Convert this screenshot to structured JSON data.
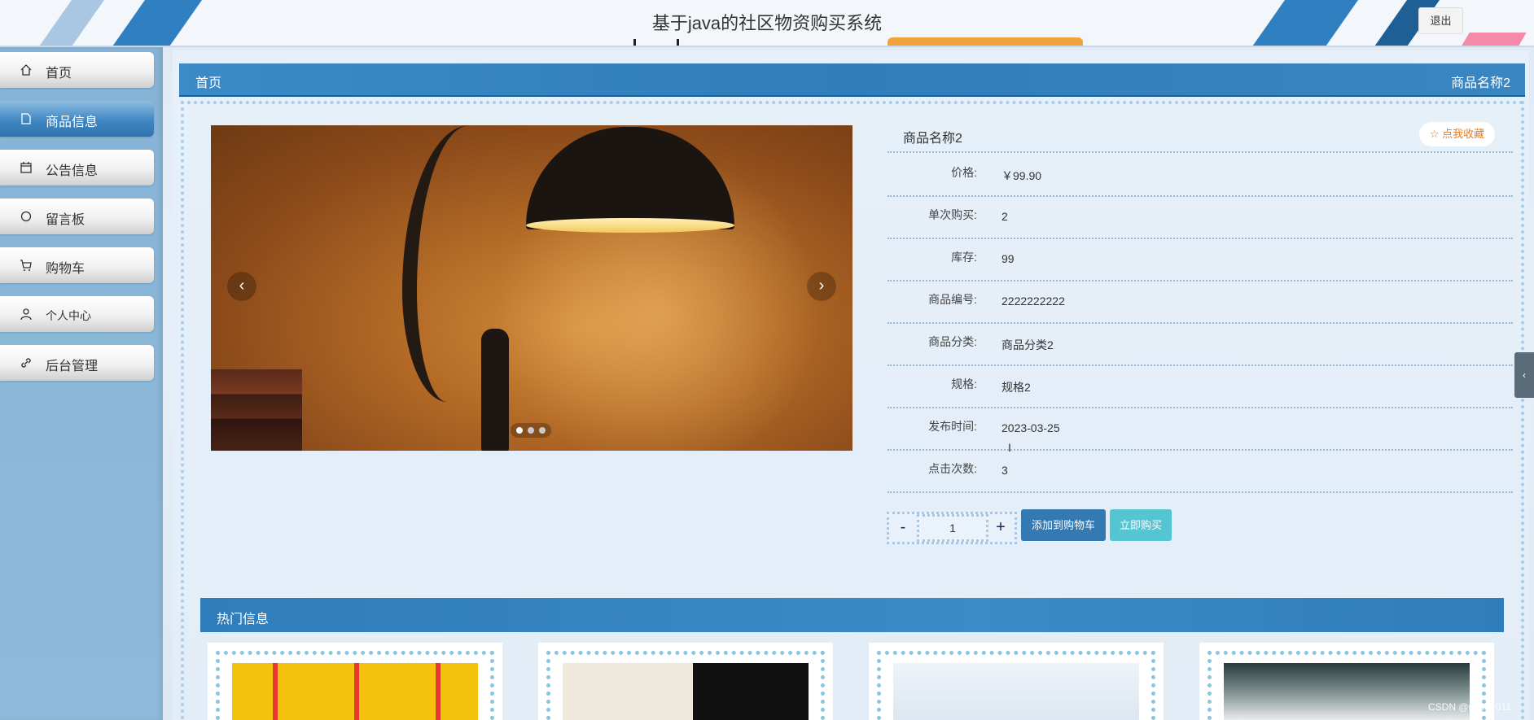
{
  "header": {
    "title": "基于java的社区物资购买系统",
    "logout_label": "退出"
  },
  "sidebar": {
    "items": [
      {
        "label": "首页",
        "icon": "home-icon",
        "active": false
      },
      {
        "label": "商品信息",
        "icon": "document-icon",
        "active": true
      },
      {
        "label": "公告信息",
        "icon": "calendar-icon",
        "active": false
      },
      {
        "label": "留言板",
        "icon": "circle-icon",
        "active": false
      },
      {
        "label": "购物车",
        "icon": "cart-icon",
        "active": false
      },
      {
        "label": "个人中心",
        "icon": "user-icon",
        "active": false
      },
      {
        "label": "后台管理",
        "icon": "link-icon",
        "active": false
      }
    ]
  },
  "breadcrumb": {
    "home": "首页",
    "current": "商品名称2"
  },
  "carousel": {
    "slides": 3,
    "active_index": 0,
    "prev_symbol": "‹",
    "next_symbol": "›"
  },
  "product": {
    "name": "商品名称2",
    "favorite_label": "☆ 点我收藏",
    "specs": [
      {
        "label": "价格:",
        "value": "￥99.90"
      },
      {
        "label": "单次购买:",
        "value": "2"
      },
      {
        "label": "库存:",
        "value": "99"
      },
      {
        "label": "商品编号:",
        "value": "2222222222"
      },
      {
        "label": "商品分类:",
        "value": "商品分类2"
      },
      {
        "label": "规格:",
        "value": "规格2"
      },
      {
        "label": "发布时间:",
        "value": "2023-03-25"
      },
      {
        "label": "点击次数:",
        "value": "3"
      }
    ]
  },
  "quantity": {
    "minus": "-",
    "value": "1",
    "plus": "+"
  },
  "actions": {
    "add_to_cart": "添加到购物车",
    "buy_now": "立即购买"
  },
  "hot": {
    "title": "热门信息",
    "cards": [
      {
        "image": "drink-image"
      },
      {
        "image": "book-image"
      },
      {
        "image": "device-image"
      },
      {
        "image": "shoe-image"
      }
    ]
  },
  "watermark": "CSDN @maker011",
  "colors": {
    "primary": "#2f7dba",
    "accent_buy": "#55c5d2",
    "favorite": "#e57b1e",
    "sidebar_bg": "#8fbadb"
  }
}
